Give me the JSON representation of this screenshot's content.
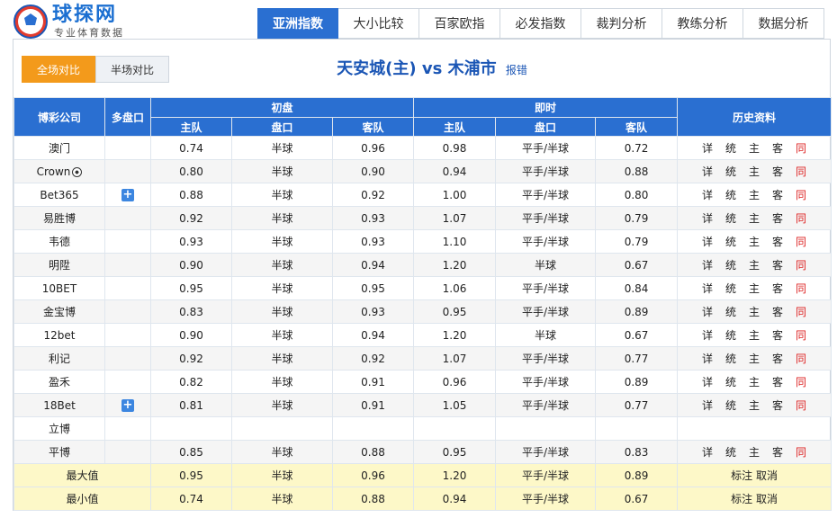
{
  "site": {
    "brand": "球探网",
    "tagline": "专业体育数据"
  },
  "nav": {
    "tabs": [
      "亚洲指数",
      "大小比较",
      "百家欧指",
      "必发指数",
      "裁判分析",
      "教练分析",
      "数据分析"
    ],
    "active": 0
  },
  "subtabs": [
    "全场对比",
    "半场对比"
  ],
  "match": {
    "home": "天安城(主)",
    "vs": "vs",
    "away": "木浦市",
    "report": "报错"
  },
  "table": {
    "headers": {
      "company": "博彩公司",
      "multi": "多盘口",
      "initial": "初盘",
      "live": "即时",
      "history": "历史资料",
      "home": "主队",
      "handicap": "盘口",
      "away": "客队"
    },
    "history_links": [
      "详",
      "统",
      "主",
      "客",
      "同"
    ],
    "rows": [
      {
        "company": "澳门",
        "plus": false,
        "ih": "0.74",
        "ip": "半球",
        "ia": "0.96",
        "lh": "0.98",
        "lp": "平手/半球",
        "la": "0.72",
        "hist": true
      },
      {
        "company": "Crown",
        "ball": true,
        "plus": false,
        "ih": "0.80",
        "ip": "半球",
        "ia": "0.90",
        "lh": "0.94",
        "lp": "平手/半球",
        "la": "0.88",
        "hist": true
      },
      {
        "company": "Bet365",
        "plus": true,
        "ih": "0.88",
        "ip": "半球",
        "ia": "0.92",
        "lh": "1.00",
        "lp": "平手/半球",
        "la": "0.80",
        "hist": true
      },
      {
        "company": "易胜博",
        "plus": false,
        "ih": "0.92",
        "ip": "半球",
        "ia": "0.93",
        "lh": "1.07",
        "lp": "平手/半球",
        "la": "0.79",
        "hist": true
      },
      {
        "company": "韦德",
        "plus": false,
        "ih": "0.93",
        "ip": "半球",
        "ia": "0.93",
        "lh": "1.10",
        "lp": "平手/半球",
        "la": "0.79",
        "hist": true
      },
      {
        "company": "明陞",
        "plus": false,
        "ih": "0.90",
        "ip": "半球",
        "ia": "0.94",
        "lh": "1.20",
        "lp": "半球",
        "la": "0.67",
        "hist": true
      },
      {
        "company": "10BET",
        "plus": false,
        "ih": "0.95",
        "ip": "半球",
        "ia": "0.95",
        "lh": "1.06",
        "lp": "平手/半球",
        "la": "0.84",
        "hist": true
      },
      {
        "company": "金宝博",
        "plus": false,
        "ih": "0.83",
        "ip": "半球",
        "ia": "0.93",
        "lh": "0.95",
        "lp": "平手/半球",
        "la": "0.89",
        "hist": true
      },
      {
        "company": "12bet",
        "plus": false,
        "ih": "0.90",
        "ip": "半球",
        "ia": "0.94",
        "lh": "1.20",
        "lp": "半球",
        "la": "0.67",
        "hist": true
      },
      {
        "company": "利记",
        "plus": false,
        "ih": "0.92",
        "ip": "半球",
        "ia": "0.92",
        "lh": "1.07",
        "lp": "平手/半球",
        "la": "0.77",
        "hist": true
      },
      {
        "company": "盈禾",
        "plus": false,
        "ih": "0.82",
        "ip": "半球",
        "ia": "0.91",
        "lh": "0.96",
        "lp": "平手/半球",
        "la": "0.89",
        "hist": true
      },
      {
        "company": "18Bet",
        "plus": true,
        "ih": "0.81",
        "ip": "半球",
        "ia": "0.91",
        "lh": "1.05",
        "lp": "平手/半球",
        "la": "0.77",
        "hist": true
      },
      {
        "company": "立博",
        "plus": false,
        "ih": "",
        "ip": "",
        "ia": "",
        "lh": "",
        "lp": "",
        "la": "",
        "hist": false
      },
      {
        "company": "平博",
        "plus": false,
        "ih": "0.85",
        "ip": "半球",
        "ia": "0.88",
        "lh": "0.95",
        "lp": "平手/半球",
        "la": "0.83",
        "hist": true
      }
    ],
    "summary": [
      {
        "label": "最大值",
        "ih": "0.95",
        "ip": "半球",
        "ia": "0.96",
        "lh": "1.20",
        "lp": "平手/半球",
        "la": "0.89",
        "actions": [
          "标注",
          "取消"
        ]
      },
      {
        "label": "最小值",
        "ih": "0.74",
        "ip": "半球",
        "ia": "0.88",
        "lh": "0.94",
        "lp": "平手/半球",
        "la": "0.67",
        "actions": [
          "标注",
          "取消"
        ]
      }
    ]
  }
}
